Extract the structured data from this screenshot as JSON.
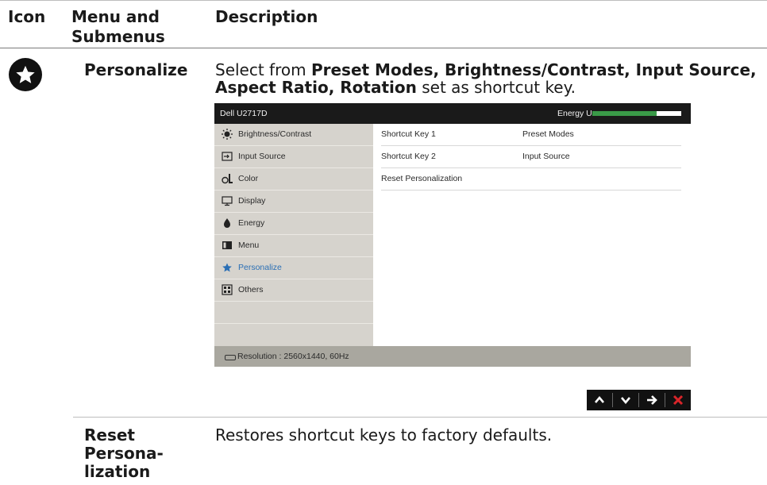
{
  "headers": {
    "icon": "Icon",
    "menu": "Menu and Submenus",
    "description": "Description"
  },
  "rows": [
    {
      "name": "Personalize",
      "icon": "star-icon"
    },
    {
      "name": "Reset Persona- lization"
    }
  ],
  "personalize_desc": {
    "prefix": "Select from ",
    "bold1": "Preset Modes, Brightness/Contrast, Input Source, Aspect Ratio, Rotation",
    "suffix": " set as shortcut key."
  },
  "reset_desc": "Restores shortcut keys to factory defaults.",
  "osd": {
    "title": "Dell U2717D",
    "energy_label": "Energy Use",
    "energy_level": 0.72,
    "menu": [
      {
        "label": "Brightness/Contrast",
        "icon": "brightness-icon"
      },
      {
        "label": "Input Source",
        "icon": "input-source-icon"
      },
      {
        "label": "Color",
        "icon": "color-icon"
      },
      {
        "label": "Display",
        "icon": "display-icon"
      },
      {
        "label": "Energy",
        "icon": "energy-icon"
      },
      {
        "label": "Menu",
        "icon": "menu-icon"
      },
      {
        "label": "Personalize",
        "icon": "star-icon",
        "selected": true
      },
      {
        "label": "Others",
        "icon": "others-icon"
      }
    ],
    "settings": [
      {
        "key": "Shortcut Key 1",
        "value": "Preset Modes"
      },
      {
        "key": "Shortcut Key 2",
        "value": "Input Source"
      },
      {
        "key": "Reset Personalization",
        "value": ""
      }
    ],
    "resolution": "Resolution : 2560x1440, 60Hz",
    "nav_buttons": [
      "up-icon",
      "down-icon",
      "right-arrow-icon",
      "close-icon"
    ],
    "colors": {
      "selected_text": "#2a6fb5",
      "energy_fill": "#3a9a48",
      "close": "#d9252a"
    }
  }
}
